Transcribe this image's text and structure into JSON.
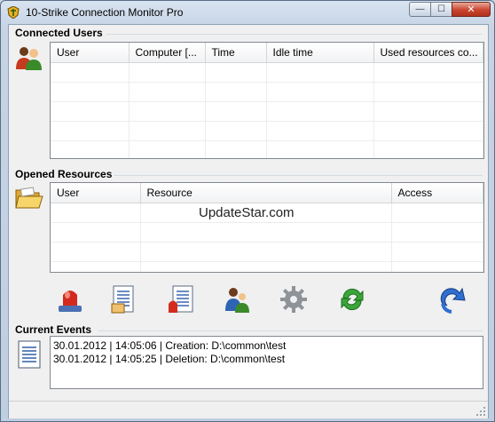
{
  "window": {
    "title": "10-Strike Connection Monitor Pro",
    "controls": {
      "minimize": "—",
      "maximize": "☐",
      "close": "✕"
    }
  },
  "connected_users": {
    "heading": "Connected Users",
    "columns": [
      "User",
      "Computer [...",
      "Time",
      "Idle time",
      "Used resources co..."
    ],
    "rows": []
  },
  "opened_resources": {
    "heading": "Opened Resources",
    "columns": [
      "User",
      "Resource",
      "Access"
    ],
    "rows": []
  },
  "watermark": "UpdateStar.com",
  "toolbar": {
    "buttons": [
      {
        "name": "alarm-users-button",
        "icon": "red-siren-icon"
      },
      {
        "name": "users-log-button",
        "icon": "log-list-icon"
      },
      {
        "name": "events-log-button",
        "icon": "log-alarm-icon"
      },
      {
        "name": "user-accounts-button",
        "icon": "users-icon"
      },
      {
        "name": "settings-button",
        "icon": "gear-icon"
      },
      {
        "name": "refresh-button",
        "icon": "refresh-icon"
      },
      {
        "name": "exit-button",
        "icon": "redo-arrow-icon"
      }
    ]
  },
  "current_events": {
    "heading": "Current Events",
    "lines": [
      "30.01.2012 | 14:05:06 | Creation: D:\\common\\test",
      "30.01.2012 | 14:05:25 | Deletion: D:\\common\\test"
    ]
  },
  "colors": {
    "title_bar": "#c6d4e5",
    "close_button": "#c9452f",
    "panel": "#f0f0f0"
  }
}
